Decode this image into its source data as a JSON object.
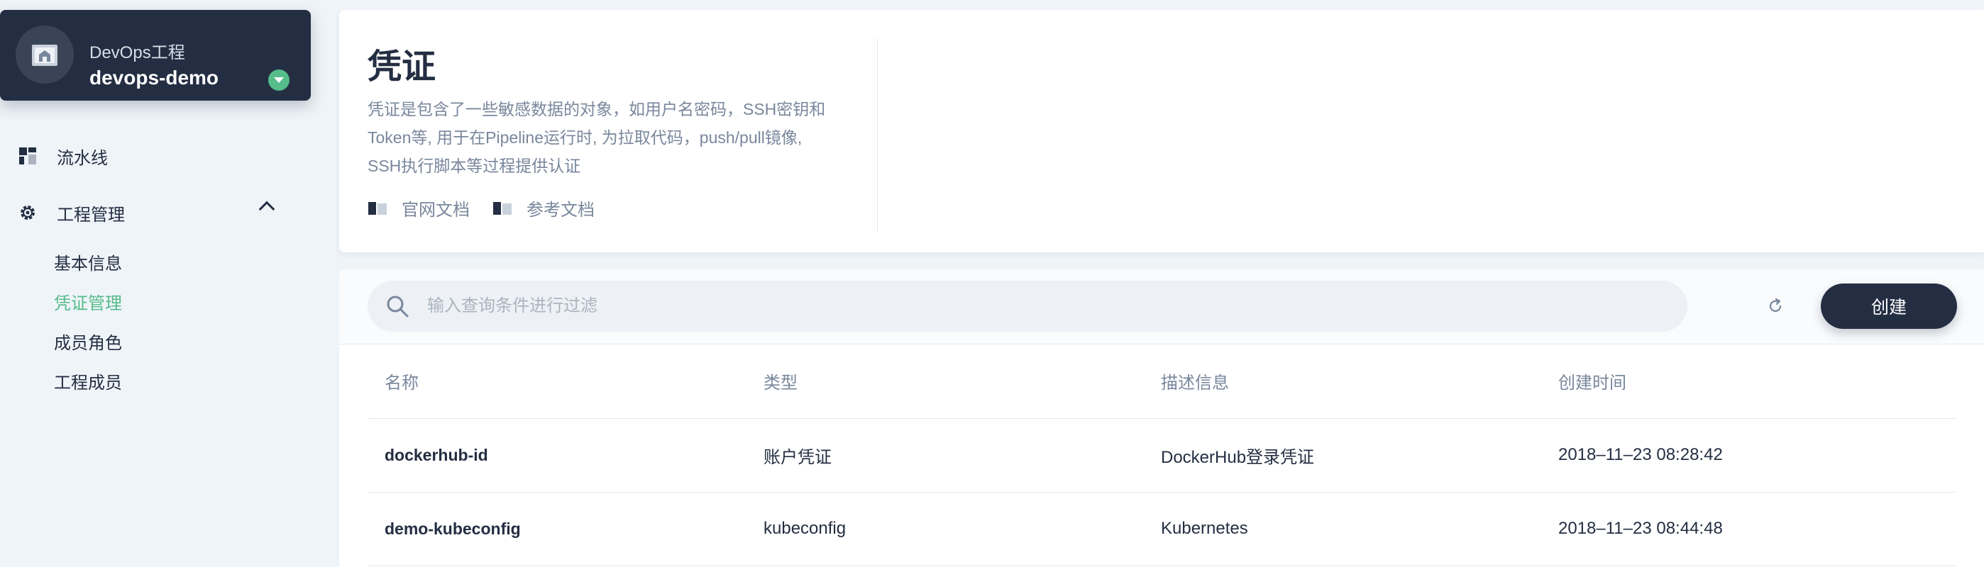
{
  "project": {
    "type_label": "DevOps工程",
    "name": "devops-demo"
  },
  "nav": {
    "pipeline_label": "流水线",
    "project_mgmt_label": "工程管理",
    "sub_items": [
      "基本信息",
      "凭证管理",
      "成员角色",
      "工程成员"
    ],
    "active_sub_item": "凭证管理"
  },
  "intro": {
    "title": "凭证",
    "description_lines": [
      "凭证是包含了一些敏感数据的对象，如用户名密码，SSH密钥和",
      "Token等, 用于在Pipeline运行时, 为拉取代码，push/pull镜像,",
      "SSH执行脚本等过程提供认证"
    ],
    "links": [
      "官网文档",
      "参考文档"
    ]
  },
  "toolbar": {
    "search_placeholder": "输入查询条件进行过滤",
    "create_label": "创建"
  },
  "table": {
    "columns": [
      "名称",
      "类型",
      "描述信息",
      "创建时间"
    ],
    "rows": [
      [
        "dockerhub-id",
        "账户凭证",
        "DockerHub登录凭证",
        "2018–11–23 08:28:42"
      ],
      [
        "demo-kubeconfig",
        "kubeconfig",
        "Kubernetes",
        "2018–11–23 08:44:48"
      ]
    ]
  },
  "colors": {
    "primary_dark": "#242e42",
    "accent_green": "#55bc8a",
    "text_muted": "#79879c",
    "background": "#eff4f9"
  },
  "icons": {
    "project": "devops-project-icon",
    "pipeline": "grid-icon",
    "project_mgmt": "gear-icon",
    "doc": "book-icon",
    "search": "search-icon",
    "refresh": "refresh-icon"
  }
}
